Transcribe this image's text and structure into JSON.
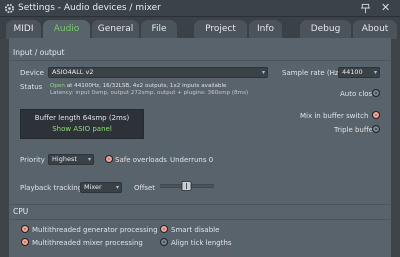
{
  "window": {
    "title": "Settings - Audio devices / mixer"
  },
  "tabs": [
    {
      "label": "MIDI"
    },
    {
      "label": "Audio"
    },
    {
      "label": "General"
    },
    {
      "label": "File"
    },
    {
      "label": "Project"
    },
    {
      "label": "Info"
    },
    {
      "label": "Debug"
    },
    {
      "label": "About"
    }
  ],
  "input_output": {
    "section_title": "Input / output",
    "device_label": "Device",
    "device_value": "ASIO4ALL v2",
    "sample_rate_label": "Sample rate (Hz)",
    "sample_rate_value": "44100",
    "status_label": "Status",
    "status_line1_open": "Open",
    "status_line1_rest": "at 44100Hz, 16/32LSB, 4x2 outputs, 1x2 inputs available",
    "status_line2": "Latency: input 0smp, output 272smp, output + plugins: 360smp (8ms)",
    "auto_close_label": "Auto close",
    "buffer_length": "Buffer length 64smp (2ms)",
    "show_asio_panel": "Show ASIO panel",
    "mix_in_buffer_switch": "Mix in buffer switch",
    "triple_buffer": "Triple buffer",
    "priority_label": "Priority",
    "priority_value": "Highest",
    "safe_overloads": "Safe overloads",
    "underruns": "Underruns 0",
    "playback_tracking_label": "Playback tracking",
    "playback_tracking_value": "Mixer",
    "offset_label": "Offset"
  },
  "cpu": {
    "section_title": "CPU",
    "multithreaded_generator": "Multithreaded generator processing",
    "multithreaded_mixer": "Multithreaded mixer processing",
    "smart_disable": "Smart disable",
    "align_tick_lengths": "Align tick lengths"
  },
  "colors": {
    "accent_green": "#6fd05a",
    "radio_on": "#e85b3a"
  }
}
